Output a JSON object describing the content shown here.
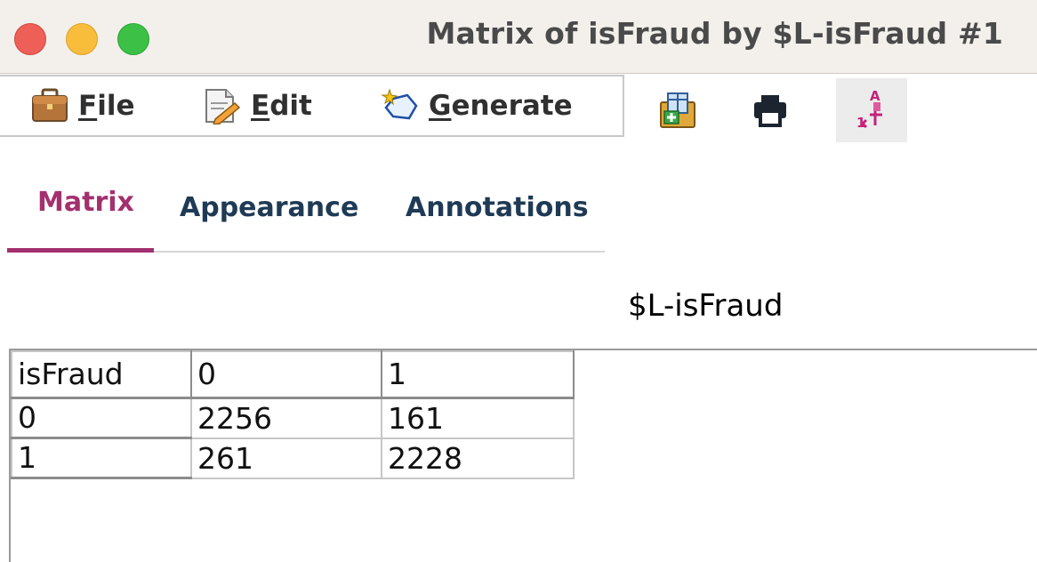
{
  "window": {
    "title": "Matrix of isFraud by $L-isFraud #1"
  },
  "menubar": {
    "items": [
      {
        "label": "File",
        "mnemonic": "F",
        "rest": "ile",
        "icon": "briefcase-icon"
      },
      {
        "label": "Edit",
        "mnemonic": "E",
        "rest": "dit",
        "icon": "edit-document-icon"
      },
      {
        "label": "Generate",
        "mnemonic": "G",
        "rest": "enerate",
        "icon": "generate-wand-icon"
      }
    ]
  },
  "toolbar": {
    "buttons": [
      {
        "icon": "export-table-icon"
      },
      {
        "icon": "print-icon"
      },
      {
        "icon": "sort-labels-icon",
        "selected": true
      }
    ]
  },
  "tabs": [
    {
      "label": "Matrix",
      "active": true
    },
    {
      "label": "Appearance",
      "active": false
    },
    {
      "label": "Annotations",
      "active": false
    }
  ],
  "matrix": {
    "column_field": "$L-isFraud",
    "row_field": "isFraud",
    "column_headers": [
      "0",
      "1"
    ],
    "rows": [
      {
        "label": "0",
        "values": [
          "2256",
          "161"
        ]
      },
      {
        "label": "1",
        "values": [
          "261",
          "2228"
        ]
      }
    ]
  },
  "colors": {
    "accent": "#a3306e",
    "tab_text": "#1f3a55",
    "close": "#ee5f58",
    "minimize": "#f8bd3b",
    "zoom": "#3cc045"
  }
}
